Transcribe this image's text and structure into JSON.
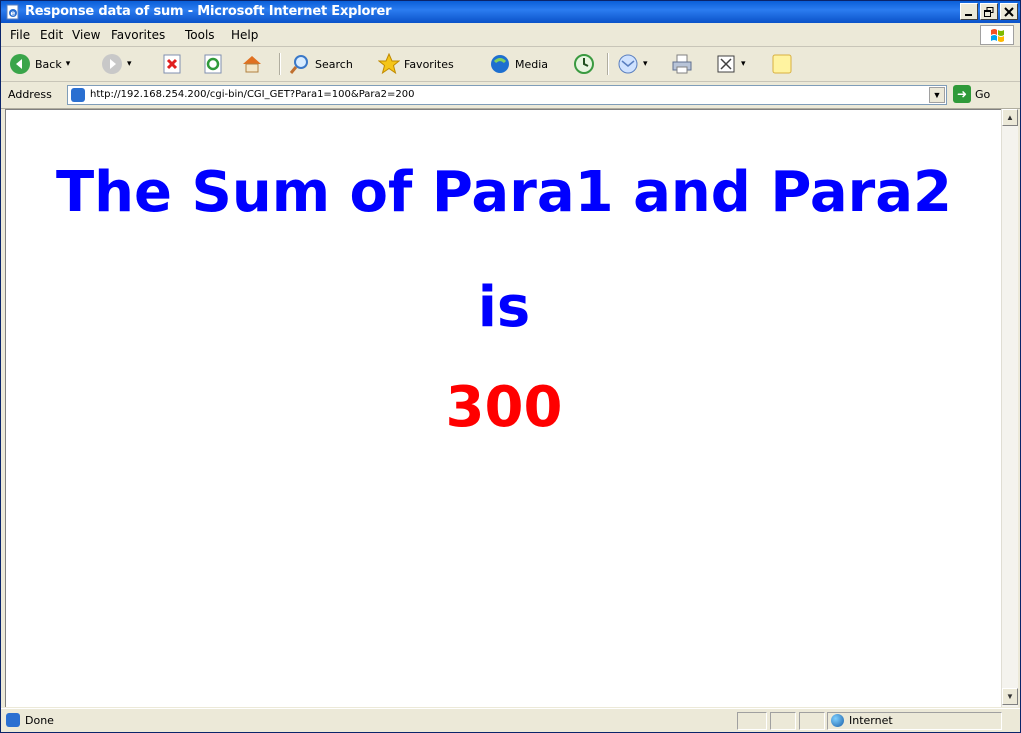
{
  "window": {
    "title": "Response data of sum - Microsoft Internet Explorer",
    "controls": [
      "_",
      "ð",
      "x"
    ]
  },
  "menu": [
    "File",
    "Edit",
    "View",
    "Favorites",
    "Tools",
    "Help"
  ],
  "toolbar": {
    "back_label": "Back",
    "search_label": "Search",
    "favorites_label": "Favorites",
    "media_label": "Media"
  },
  "address": {
    "label": "Address",
    "url": "http://192.168.254.200/cgi-bin/CGI_GET?Para1=100&Para2=200",
    "go_label": "Go"
  },
  "content": {
    "line1": "The Sum of Para1 and Para2",
    "line2": "is",
    "result": "300",
    "colors": {
      "heading": "#0000ff",
      "result": "#ff0000"
    }
  },
  "status": {
    "text": "Done",
    "zone": "Internet"
  }
}
